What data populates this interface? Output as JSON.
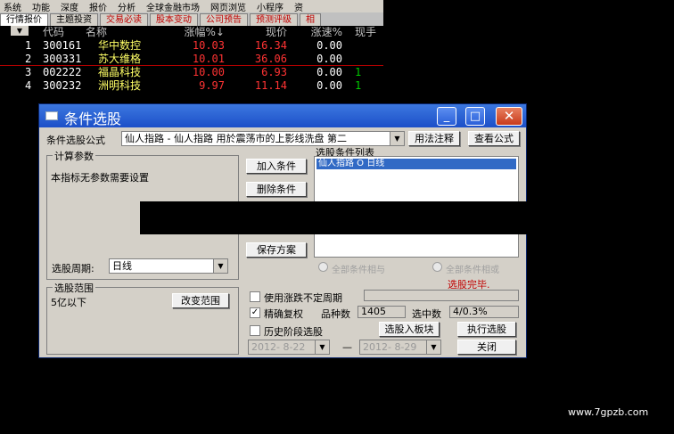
{
  "menu": [
    "系统",
    "功能",
    "深度",
    "报价",
    "分析",
    "全球金融市场",
    "网页浏览",
    "小程序",
    "资"
  ],
  "tabs": [
    {
      "label": "行情报价",
      "colored": false,
      "active": true
    },
    {
      "label": "主题投资",
      "colored": false,
      "active": false
    },
    {
      "label": "交易必读",
      "colored": true,
      "active": false
    },
    {
      "label": "股本变动",
      "colored": true,
      "active": false
    },
    {
      "label": "公司预告",
      "colored": true,
      "active": false
    },
    {
      "label": "预测评级",
      "colored": true,
      "active": false
    },
    {
      "label": "相",
      "colored": true,
      "active": false
    }
  ],
  "table": {
    "headers": {
      "sort": "▼",
      "code": "代码",
      "name": "名称",
      "change": "涨幅%↓",
      "price": "现价",
      "speed": "涨速%",
      "now": "现手"
    },
    "rows": [
      {
        "idx": "1",
        "code": "300161",
        "name": "华中数控",
        "change": "10.03",
        "price": "16.34",
        "speed": "0.00",
        "now": ""
      },
      {
        "idx": "2",
        "code": "300331",
        "name": "苏大维格",
        "change": "10.01",
        "price": "36.06",
        "speed": "0.00",
        "now": ""
      },
      {
        "idx": "3",
        "code": "002222",
        "name": "福晶科技",
        "change": "10.00",
        "price": "6.93",
        "speed": "0.00",
        "now": "1"
      },
      {
        "idx": "4",
        "code": "300232",
        "name": "洲明科技",
        "change": "9.97",
        "price": "11.14",
        "speed": "0.00",
        "now": "1"
      }
    ]
  },
  "dialog": {
    "title": "条件选股",
    "formula_label": "条件选股公式",
    "formula_value": "仙人指路 - 仙人指路 用於震荡市的上影线洗盘 第二",
    "usage_button": "用法注释",
    "view_formula_button": "查看公式",
    "params_group": "计算参数",
    "params_text": "本指标无参数需要设置",
    "add_button": "加入条件",
    "delete_button": "删除条件",
    "save_button": "保存方案",
    "cond_list_label": "选股条件列表",
    "cond_item": "仙人指路  O  日线",
    "all_and": "全部条件相与",
    "all_or": "全部条件相或",
    "status": "选股完毕.",
    "period_label": "选股周期:",
    "period_value": "日线",
    "range_group": "选股范围",
    "range_text": "5亿以下",
    "change_range_button": "改变范围",
    "use_period_label": "使用涨跌不定周期",
    "exact_label": "精确复权",
    "count_label": "品种数",
    "count_value": "1405",
    "selected_label": "选中数",
    "selected_value": "4/0.3%",
    "history_label": "历史阶段选股",
    "date_from": "2012- 8-22",
    "date_dash": "—",
    "date_to": "2012- 8-29",
    "to_board_button": "选股入板块",
    "execute_button": "执行选股",
    "close_button": "关闭"
  },
  "watermark": "www.7gpzb.com"
}
